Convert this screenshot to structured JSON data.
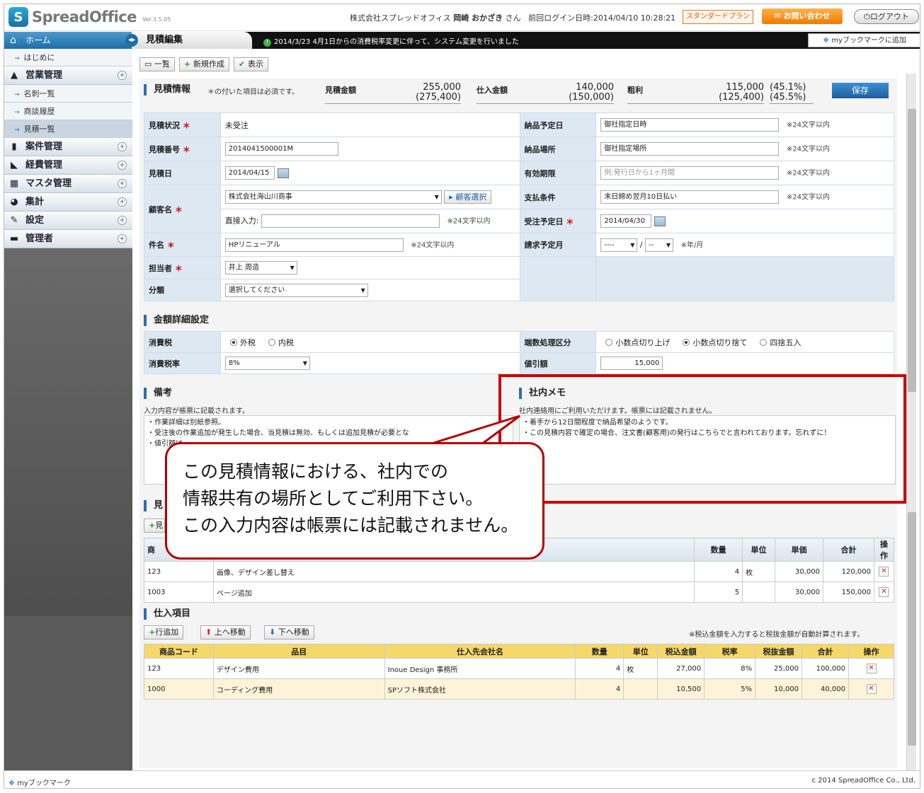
{
  "header": {
    "logo_mark": "S",
    "logo_text": "SpreadOffice",
    "version": "Ver.3.5.05",
    "company": "株式会社スプレッドオフィス",
    "user_name": "岡崎 おかざき",
    "honorific": "さん",
    "last_login_label": "前回ログイン日時:",
    "last_login": "2014/04/10 10:28:21",
    "plan": "スタンダードプラン",
    "contact": "お問い合わせ",
    "logout": "ログアウト"
  },
  "topbar": {
    "home": "ホーム",
    "page_title": "見積編集",
    "notice": "2014/3/23 4月1日からの消費税率変更に伴って、システム変更を行いました",
    "bookmark_add": "myブックマークに追加"
  },
  "sidebar": {
    "items": [
      {
        "type": "sub",
        "label": "はじめに"
      },
      {
        "type": "main",
        "label": "営業管理",
        "icon": "▲"
      },
      {
        "type": "sub",
        "label": "名刺一覧"
      },
      {
        "type": "sub",
        "label": "商談履歴"
      },
      {
        "type": "sub",
        "label": "見積一覧"
      },
      {
        "type": "main",
        "label": "案件管理",
        "icon": "▮"
      },
      {
        "type": "main",
        "label": "経費管理",
        "icon": "◣"
      },
      {
        "type": "main",
        "label": "マスタ管理",
        "icon": "▦"
      },
      {
        "type": "main",
        "label": "集計",
        "icon": "◕"
      },
      {
        "type": "main",
        "label": "設定",
        "icon": "✎"
      },
      {
        "type": "main",
        "label": "管理者",
        "icon": "▬"
      }
    ],
    "expand": "+"
  },
  "toolbar": {
    "list": "一覧",
    "new": "新規作成",
    "view": "表示"
  },
  "summary": {
    "title": "見積情報",
    "required_note": "＊の付いた項目は必須です。",
    "estimate_label": "見積金額",
    "estimate_val": "255,000",
    "estimate_tax": "(275,400)",
    "purchase_label": "仕入金額",
    "purchase_val": "140,000",
    "purchase_tax": "(150,000)",
    "gross_label": "粗利",
    "gross_val": "115,000",
    "gross_tax": "(125,400)",
    "gross_pct": "(45.1%)",
    "gross_pct_tax": "(45.5%)",
    "save": "保存"
  },
  "form": {
    "status_label": "見積状況",
    "status_val": "未受注",
    "number_label": "見積番号",
    "number_val": "2014041500001M",
    "date_label": "見積日",
    "date_val": "2014/04/15",
    "customer_label": "顧客名",
    "customer_val": "株式会社海山川商事",
    "customer_btn": "顧客選択",
    "direct_label": "直接入力:",
    "direct_note": "※24文字以内",
    "subject_label": "件名",
    "subject_val": "HPリニューアル",
    "subject_note": "※24文字以内",
    "staff_label": "担当者",
    "staff_val": "井上 周造",
    "category_label": "分類",
    "category_val": "選択してください",
    "delivery_date_label": "納品予定日",
    "delivery_date_val": "御社指定日時",
    "delivery_date_note": "※24文字以内",
    "delivery_place_label": "納品場所",
    "delivery_place_val": "御社指定場所",
    "delivery_place_note": "※24文字以内",
    "valid_label": "有効期限",
    "valid_ph": "例:発行日から1ヶ月間",
    "valid_note": "※24文字以内",
    "payment_label": "支払条件",
    "payment_val": "末日締め翌月10日払い",
    "payment_note": "※24文字以内",
    "order_date_label": "受注予定日",
    "order_date_val": "2014/04/30",
    "invoice_label": "請求予定月",
    "invoice_y": "----",
    "invoice_sep": "/",
    "invoice_m": "--",
    "invoice_note": "※年/月"
  },
  "amount": {
    "title": "金額詳細設定",
    "tax_label": "消費税",
    "tax_opt1": "外税",
    "tax_opt2": "内税",
    "rate_label": "消費税率",
    "rate_val": "8%",
    "round_label": "端数処理区分",
    "round_opt1": "小数点切り上げ",
    "round_opt2": "小数点切り捨て",
    "round_opt3": "四捨五入",
    "discount_label": "値引額",
    "discount_val": "15,000"
  },
  "remarks": {
    "title": "備考",
    "desc": "入力内容が帳票に記載されます。",
    "lines": [
      "・作業詳細は別紙参照。",
      "・受注後の作業追加が発生した場合、当見積は無効、もしくは追加見積が必要とな",
      "・値引額は"
    ]
  },
  "memo": {
    "title": "社内メモ",
    "desc": "社内連絡用にご利用いただけます。帳票には記載されません。",
    "lines": [
      "・着手から12日間程度で納品希望のようです。",
      "・この見積内容で確定の場合、注文書(顧客用)の発行はこちらでと言われております。忘れずに！"
    ]
  },
  "estimate_items": {
    "title": "見",
    "add": "見",
    "headers": [
      "商",
      "",
      "数量",
      "単位",
      "単価",
      "合計",
      "操作"
    ],
    "rows": [
      {
        "code": "123",
        "name": "画像、デザイン差し替え",
        "qty": "4",
        "unit": "枚",
        "price": "30,000",
        "total": "120,000"
      },
      {
        "code": "1003",
        "name": "ページ追加",
        "qty": "5",
        "unit": "",
        "price": "30,000",
        "total": "150,000"
      }
    ]
  },
  "purchase_items": {
    "title": "仕入項目",
    "add_row": "行追加",
    "move_up": "上へ移動",
    "move_down": "下へ移動",
    "auto_note": "※税込金額を入力すると税抜金額が自動計算されます。",
    "headers": [
      "商品コード",
      "品目",
      "仕入先会社名",
      "数量",
      "単位",
      "税込金額",
      "税率",
      "税抜金額",
      "合計",
      "操作"
    ],
    "rows": [
      {
        "code": "123",
        "name": "デザイン費用",
        "vendor": "Inoue Design 事務所",
        "qty": "4",
        "unit": "枚",
        "incl": "27,000",
        "rate": "8%",
        "excl": "25,000",
        "total": "100,000"
      },
      {
        "code": "1000",
        "name": "コーディング費用",
        "vendor": "SPソフト株式会社",
        "qty": "4",
        "unit": "",
        "incl": "10,500",
        "rate": "5%",
        "excl": "10,000",
        "total": "40,000"
      }
    ]
  },
  "footer": {
    "bookmark": "myブックマーク",
    "copyright": "c 2014 SpreadOffice Co., Ltd."
  },
  "callout": {
    "lines": [
      "この見積情報における、社内での",
      "情報共有の場所としてご利用下さい。",
      "この入力内容は帳票には記載されません。"
    ]
  },
  "colors": {
    "accent": "#2b6fb0",
    "highlight_red": "#c00000",
    "purchase_header": "#f4d86a"
  }
}
